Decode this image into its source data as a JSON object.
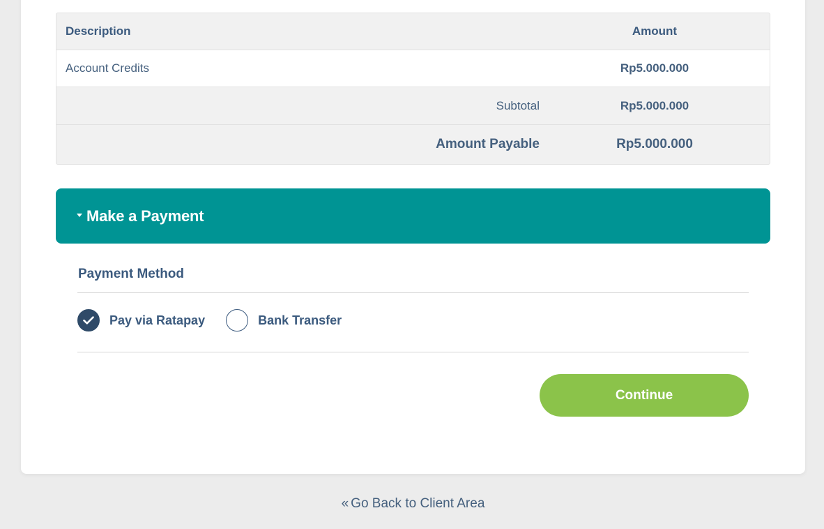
{
  "invoice": {
    "header": {
      "description": "Description",
      "amount": "Amount"
    },
    "items": [
      {
        "description": "Account Credits",
        "amount": "Rp5.000.000"
      }
    ],
    "subtotal_label": "Subtotal",
    "subtotal_value": "Rp5.000.000",
    "total_label": "Amount Payable",
    "total_value": "Rp5.000.000"
  },
  "payment": {
    "title": "Make a Payment",
    "method_label": "Payment Method",
    "options": [
      {
        "label": "Pay via Ratapay",
        "selected": true
      },
      {
        "label": "Bank Transfer",
        "selected": false
      }
    ],
    "continue_label": "Continue"
  },
  "footer": {
    "back_label": "Go Back to Client Area",
    "back_icon": "double-chevron-left-icon"
  },
  "colors": {
    "accent": "#009494",
    "continue": "#8bc34a",
    "text": "#3b5a7e",
    "selected_radio": "#2f4a68"
  }
}
